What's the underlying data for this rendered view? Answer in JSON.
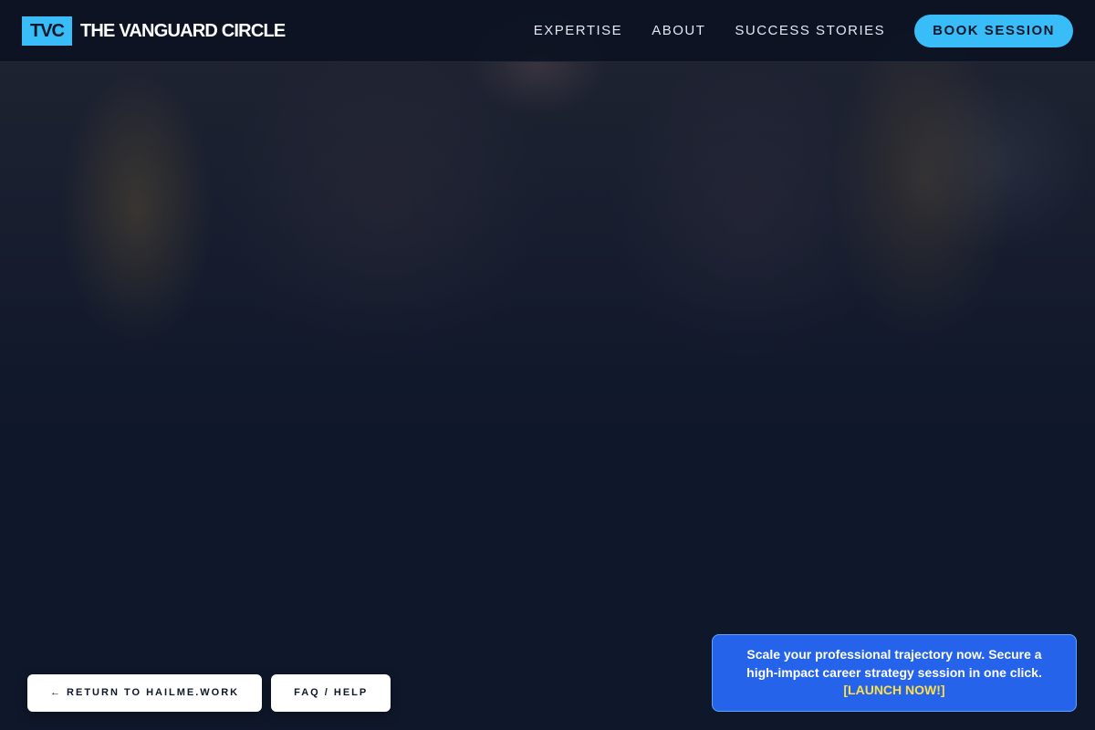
{
  "brand": {
    "badge": "TVC",
    "name": "THE VANGUARD CIRCLE"
  },
  "nav": {
    "links": [
      "EXPERTISE",
      "ABOUT",
      "SUCCESS STORIES"
    ],
    "cta": "BOOK SESSION"
  },
  "footer_buttons": {
    "return_label": "← RETURN TO HAILME.WORK",
    "faq_label": "FAQ / HELP"
  },
  "promo": {
    "text": "Scale your professional trajectory now. Secure a high-impact career strategy session in one click.",
    "cta": "[LAUNCH NOW!]"
  },
  "colors": {
    "background": "#0f172a",
    "accent": "#38bdf8",
    "promo_bg": "#2563eb",
    "promo_cta": "#fde047"
  }
}
